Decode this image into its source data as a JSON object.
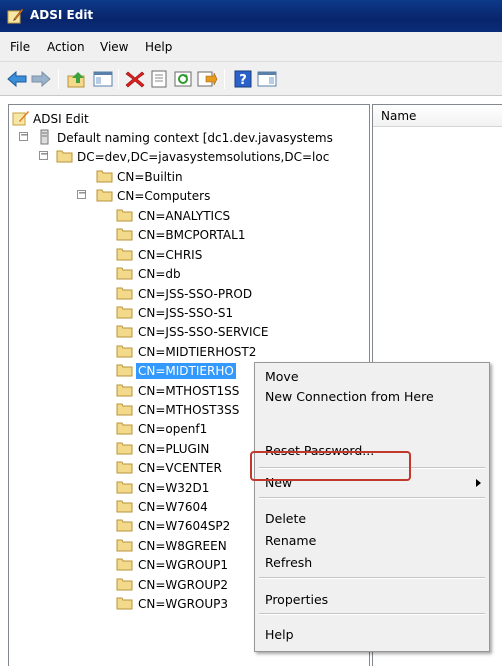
{
  "window": {
    "title": "ADSI Edit"
  },
  "menubar": {
    "items": [
      "File",
      "Action",
      "View",
      "Help"
    ]
  },
  "toolbar": {
    "buttons": [
      "back-icon",
      "forward-icon",
      "up-folder-icon",
      "show-hide-console-tree-icon",
      "delete-icon",
      "properties-icon",
      "refresh-icon",
      "export-list-icon",
      "help-icon",
      "show-action-pane-icon"
    ]
  },
  "tree": {
    "root": "ADSI Edit",
    "naming_context": "Default naming context [dc1.dev.javasystems",
    "domain": "DC=dev,DC=javasystemsolutions,DC=loc",
    "builtin": "CN=Builtin",
    "computers": "CN=Computers",
    "computer_items": [
      "CN=ANALYTICS",
      "CN=BMCPORTAL1",
      "CN=CHRIS",
      "CN=db",
      "CN=JSS-SSO-PROD",
      "CN=JSS-SSO-S1",
      "CN=JSS-SSO-SERVICE",
      "CN=MIDTIERHOST2",
      "CN=MIDTIERHO",
      "CN=MTHOST1SS",
      "CN=MTHOST3SS",
      "CN=openf1",
      "CN=PLUGIN",
      "CN=VCENTER",
      "CN=W32D1",
      "CN=W7604",
      "CN=W7604SP2",
      "CN=W8GREEN",
      "CN=WGROUP1",
      "CN=WGROUP2",
      "CN=WGROUP3"
    ],
    "selected_item": "CN=MIDTIERHO"
  },
  "list": {
    "column_name": "Name"
  },
  "context_menu": {
    "move": "Move",
    "new_connection": "New Connection from Here",
    "reset_password": "Reset Password...",
    "new": "New",
    "delete": "Delete",
    "rename": "Rename",
    "refresh": "Refresh",
    "properties": "Properties",
    "help": "Help"
  },
  "colors": {
    "title_bar": "#0a2c78",
    "selection": "#3399ff",
    "highlight_box": "#c0392b",
    "folder": "#f3d98a"
  }
}
